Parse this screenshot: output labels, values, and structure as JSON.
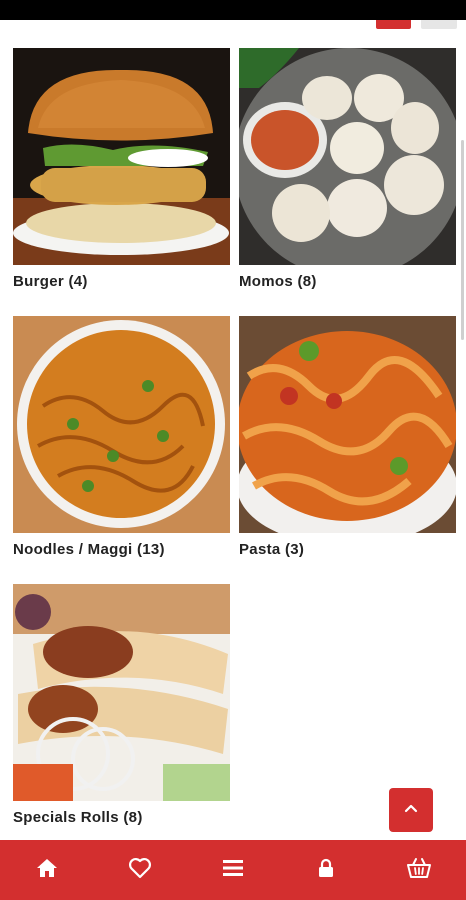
{
  "categories": [
    {
      "name": "Burger",
      "count_label": "Burger (4)",
      "image": "burger-photo"
    },
    {
      "name": "Momos",
      "count_label": "Momos (8)",
      "image": "momos-photo"
    },
    {
      "name": "Noodles / Maggi",
      "count_label": "Noodles / Maggi (13)",
      "image": "noodles-photo"
    },
    {
      "name": "Pasta",
      "count_label": "Pasta (3)",
      "image": "pasta-photo"
    },
    {
      "name": "Specials Rolls",
      "count_label": "Specials Rolls (8)",
      "image": "rolls-photo"
    }
  ],
  "bottom_nav": {
    "items": [
      {
        "icon": "home-icon"
      },
      {
        "icon": "heart-icon"
      },
      {
        "icon": "menu-icon"
      },
      {
        "icon": "lock-icon"
      },
      {
        "icon": "basket-icon"
      }
    ]
  },
  "back_to_top": {
    "icon": "chevron-up-icon"
  },
  "colors": {
    "accent": "#d32f2f",
    "text": "#222222",
    "background": "#ffffff"
  }
}
